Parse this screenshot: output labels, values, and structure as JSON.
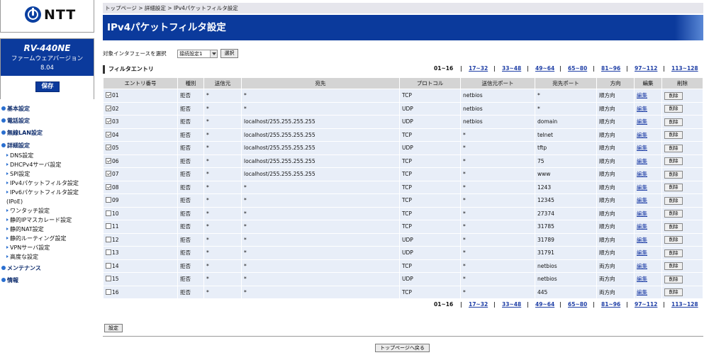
{
  "logo": {
    "brand": "NTT"
  },
  "device": {
    "model": "RV-440NE",
    "firmware_label": "ファームウェアバージョン",
    "firmware_version": "8.04",
    "save_label": "保存"
  },
  "nav": {
    "categories": [
      {
        "label": "基本設定"
      },
      {
        "label": "電話設定"
      },
      {
        "label": "無線LAN設定"
      },
      {
        "label": "詳細設定"
      },
      {
        "label": "メンテナンス"
      },
      {
        "label": "情報"
      }
    ],
    "detail_items": [
      {
        "label": "DNS設定"
      },
      {
        "label": "DHCPv4サーバ設定"
      },
      {
        "label": "SPI設定"
      },
      {
        "label": "IPv4パケットフィルタ設定"
      },
      {
        "label": "IPv6パケットフィルタ設定"
      },
      {
        "label": "(IPoE)"
      },
      {
        "label": "ワンタッチ設定"
      },
      {
        "label": "静的IPマスカレード設定"
      },
      {
        "label": "静的NAT設定"
      },
      {
        "label": "静的ルーティング設定"
      },
      {
        "label": "VPNサーバ設定"
      },
      {
        "label": "高度な設定"
      }
    ]
  },
  "breadcrumb": "トップページ > 詳細設定 > IPv4パケットフィルタ設定",
  "page_title": "IPv4パケットフィルタ設定",
  "interface": {
    "label": "対象インタフェースを選択",
    "selected": "接続設定1",
    "select_button": "選択"
  },
  "section_title": "フィルタエントリ",
  "pager": {
    "current": "01~16",
    "separator": "|",
    "links": [
      "17~32",
      "33~48",
      "49~64",
      "65~80",
      "81~96",
      "97~112",
      "113~128"
    ]
  },
  "table": {
    "headers": [
      "エントリ番号",
      "種別",
      "送信元",
      "宛先",
      "プロトコル",
      "送信元ポート",
      "宛先ポート",
      "方向",
      "編集",
      "削除"
    ],
    "edit_label": "編集",
    "delete_label": "削除",
    "rows": [
      {
        "checked": true,
        "entry": "01",
        "type": "拒否",
        "src": "*",
        "dst": "*",
        "proto": "TCP",
        "src_port": "netbios",
        "dst_port": "*",
        "dir": "順方向"
      },
      {
        "checked": true,
        "entry": "02",
        "type": "拒否",
        "src": "*",
        "dst": "*",
        "proto": "UDP",
        "src_port": "netbios",
        "dst_port": "*",
        "dir": "順方向"
      },
      {
        "checked": true,
        "entry": "03",
        "type": "拒否",
        "src": "*",
        "dst": "localhost/255.255.255.255",
        "proto": "UDP",
        "src_port": "netbios",
        "dst_port": "domain",
        "dir": "順方向"
      },
      {
        "checked": true,
        "entry": "04",
        "type": "拒否",
        "src": "*",
        "dst": "localhost/255.255.255.255",
        "proto": "TCP",
        "src_port": "*",
        "dst_port": "telnet",
        "dir": "順方向"
      },
      {
        "checked": true,
        "entry": "05",
        "type": "拒否",
        "src": "*",
        "dst": "localhost/255.255.255.255",
        "proto": "UDP",
        "src_port": "*",
        "dst_port": "tftp",
        "dir": "順方向"
      },
      {
        "checked": true,
        "entry": "06",
        "type": "拒否",
        "src": "*",
        "dst": "localhost/255.255.255.255",
        "proto": "TCP",
        "src_port": "*",
        "dst_port": "75",
        "dir": "順方向"
      },
      {
        "checked": true,
        "entry": "07",
        "type": "拒否",
        "src": "*",
        "dst": "localhost/255.255.255.255",
        "proto": "TCP",
        "src_port": "*",
        "dst_port": "www",
        "dir": "順方向"
      },
      {
        "checked": true,
        "entry": "08",
        "type": "拒否",
        "src": "*",
        "dst": "*",
        "proto": "TCP",
        "src_port": "*",
        "dst_port": "1243",
        "dir": "順方向"
      },
      {
        "checked": false,
        "entry": "09",
        "type": "拒否",
        "src": "*",
        "dst": "*",
        "proto": "TCP",
        "src_port": "*",
        "dst_port": "12345",
        "dir": "順方向"
      },
      {
        "checked": false,
        "entry": "10",
        "type": "拒否",
        "src": "*",
        "dst": "*",
        "proto": "TCP",
        "src_port": "*",
        "dst_port": "27374",
        "dir": "順方向"
      },
      {
        "checked": false,
        "entry": "11",
        "type": "拒否",
        "src": "*",
        "dst": "*",
        "proto": "TCP",
        "src_port": "*",
        "dst_port": "31785",
        "dir": "順方向"
      },
      {
        "checked": false,
        "entry": "12",
        "type": "拒否",
        "src": "*",
        "dst": "*",
        "proto": "UDP",
        "src_port": "*",
        "dst_port": "31789",
        "dir": "順方向"
      },
      {
        "checked": false,
        "entry": "13",
        "type": "拒否",
        "src": "*",
        "dst": "*",
        "proto": "UDP",
        "src_port": "*",
        "dst_port": "31791",
        "dir": "順方向"
      },
      {
        "checked": false,
        "entry": "14",
        "type": "拒否",
        "src": "*",
        "dst": "*",
        "proto": "TCP",
        "src_port": "*",
        "dst_port": "netbios",
        "dir": "両方向"
      },
      {
        "checked": false,
        "entry": "15",
        "type": "拒否",
        "src": "*",
        "dst": "*",
        "proto": "UDP",
        "src_port": "*",
        "dst_port": "netbios",
        "dir": "両方向"
      },
      {
        "checked": false,
        "entry": "16",
        "type": "拒否",
        "src": "*",
        "dst": "*",
        "proto": "TCP",
        "src_port": "*",
        "dst_port": "445",
        "dir": "両方向"
      }
    ]
  },
  "buttons": {
    "settings": "設定",
    "back_to_top": "トップページへ戻る"
  },
  "colors": {
    "brand_blue": "#0b3a9c",
    "link_blue": "#1f3fa6",
    "row_bg": "#e8eef8",
    "header_bg": "#d4d4d4"
  }
}
